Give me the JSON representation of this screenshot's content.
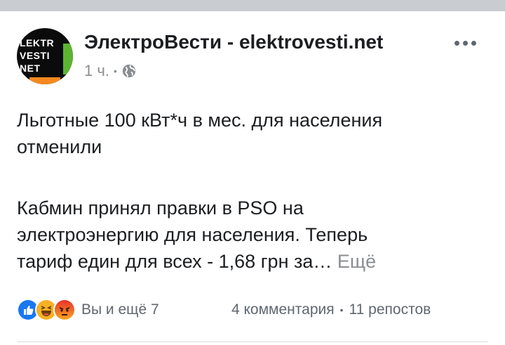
{
  "post": {
    "page_name": "ЭлектроВести - elektrovesti.net",
    "avatar_text": [
      "LEKTR",
      "VESTI",
      "NET"
    ],
    "time": "1 ч.",
    "privacy_icon": "globe-icon",
    "more_icon": "more-icon",
    "lines": [
      "Льготные 100 кВт*ч в мес. для населения",
      "отменили",
      "Кабмин принял правки в PSO на",
      "электроэнергию для населения. Теперь",
      "тариф един для всех - 1,68 грн за…"
    ],
    "see_more": "Ещё",
    "reactions": [
      "like-icon",
      "haha-icon",
      "angry-icon"
    ],
    "reactions_label": "Вы и ещё 7",
    "comments": "4 комментария",
    "shares": "11 репостов"
  },
  "colors": {
    "secondary_text": "#606770",
    "meta_text": "#8a8d91",
    "like_blue": "#1877f2",
    "haha_yellow": "#f7b125",
    "angry_orange": "#e9710f"
  }
}
